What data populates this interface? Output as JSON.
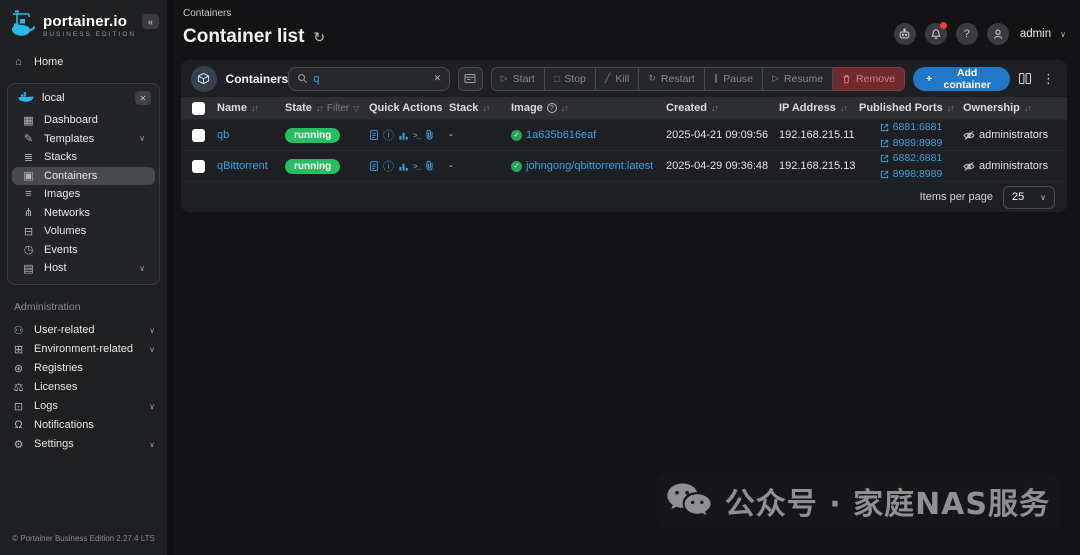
{
  "app": {
    "logo_title": "portainer.io",
    "logo_subtitle": "BUSINESS EDITION",
    "footer": "© Portainer Business Edition 2.27.4 LTS"
  },
  "icons": {
    "collapse": "«",
    "chevron_down": "∨",
    "close": "✕",
    "kebab": "⋮",
    "sort": "↓↑",
    "funnel": "▽",
    "refresh": "↻",
    "plus": "+",
    "question": "?",
    "start": "▷",
    "stop": "□",
    "kill": "╱",
    "restart": "↻",
    "pause": "∥",
    "resume": "▷",
    "console": ">_",
    "info": "ⓘ",
    "check": "✓"
  },
  "sidebar": {
    "home": {
      "label": "Home",
      "icon": "⌂"
    },
    "environment": {
      "name": "local"
    },
    "env_items": [
      {
        "label": "Dashboard",
        "icon": "▦",
        "expandable": false,
        "active": false
      },
      {
        "label": "Templates",
        "icon": "✎",
        "expandable": true,
        "active": false
      },
      {
        "label": "Stacks",
        "icon": "≣",
        "expandable": false,
        "active": false
      },
      {
        "label": "Containers",
        "icon": "▣",
        "expandable": false,
        "active": true
      },
      {
        "label": "Images",
        "icon": "≡",
        "expandable": false,
        "active": false
      },
      {
        "label": "Networks",
        "icon": "⋔",
        "expandable": false,
        "active": false
      },
      {
        "label": "Volumes",
        "icon": "⊟",
        "expandable": false,
        "active": false
      },
      {
        "label": "Events",
        "icon": "◷",
        "expandable": false,
        "active": false
      },
      {
        "label": "Host",
        "icon": "▤",
        "expandable": true,
        "active": false
      }
    ],
    "admin_section": "Administration",
    "admin_items": [
      {
        "label": "User-related",
        "icon": "⚇",
        "expandable": true
      },
      {
        "label": "Environment-related",
        "icon": "⊞",
        "expandable": true
      },
      {
        "label": "Registries",
        "icon": "⊛",
        "expandable": false
      },
      {
        "label": "Licenses",
        "icon": "⚖",
        "expandable": false
      },
      {
        "label": "Logs",
        "icon": "⊡",
        "expandable": true
      },
      {
        "label": "Notifications",
        "icon": "Ω",
        "expandable": false
      },
      {
        "label": "Settings",
        "icon": "⚙",
        "expandable": true
      }
    ]
  },
  "header": {
    "breadcrumb": "Containers",
    "title": "Container list",
    "username": "admin"
  },
  "widget": {
    "title": "Containers",
    "search_value": "q",
    "actions": [
      "Start",
      "Stop",
      "Kill",
      "Restart",
      "Pause",
      "Resume",
      "Remove"
    ],
    "add_label": "Add container"
  },
  "table": {
    "columns": [
      "Name",
      "State",
      "Quick Actions",
      "Stack",
      "Image",
      "Created",
      "IP Address",
      "Published Ports",
      "Ownership"
    ],
    "filter_label": "Filter",
    "rows": [
      {
        "name": "qb",
        "state": "running",
        "stack": "-",
        "image": "1a635b616eaf",
        "created": "2025-04-21 09:09:56",
        "ip": "192.168.215.11",
        "ports": [
          "6881:6881",
          "8989:8989"
        ],
        "ownership": "administrators"
      },
      {
        "name": "qBittorrent",
        "state": "running",
        "stack": "-",
        "image": "johngong/qbittorrent:latest",
        "created": "2025-04-29 09:36:48",
        "ip": "192.168.215.13",
        "ports": [
          "6882:6881",
          "8998:8989"
        ],
        "ownership": "administrators"
      }
    ]
  },
  "pagination": {
    "label": "Items per page",
    "value": "25"
  },
  "watermark": {
    "text": "公众号 · 家庭NAS服务"
  },
  "colors": {
    "accent_blue": "#2178c9",
    "link_blue": "#3d9fe0",
    "running_green": "#27bd63",
    "danger_red": "#6e2b2f",
    "panel_bg": "#1e1f22",
    "sidebar_bg": "#1e1f21",
    "table_header_bg": "#2d2e32"
  }
}
